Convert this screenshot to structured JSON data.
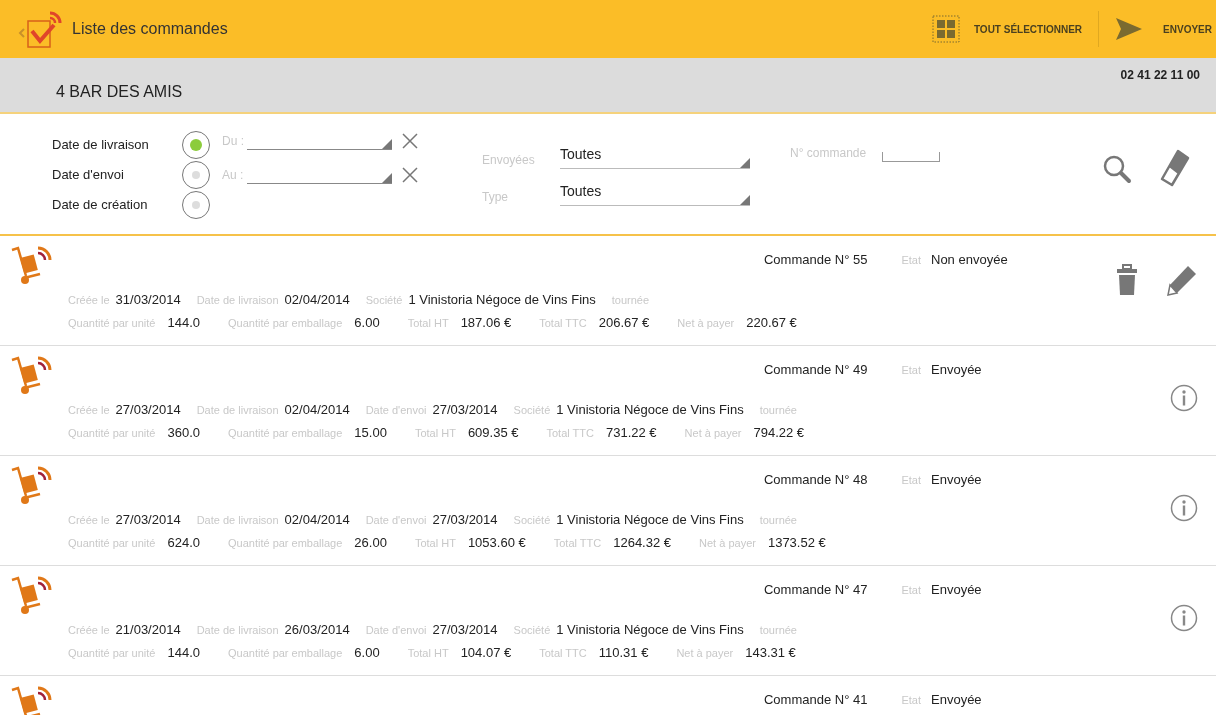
{
  "app_bar": {
    "title": "Liste des commandes",
    "actions": [
      {
        "kind": "select-all",
        "label": "TOUT SÉLECTIONNER"
      },
      {
        "kind": "send",
        "label": "ENVOYER"
      }
    ]
  },
  "customer": {
    "name": "4  BAR DES AMIS",
    "phone": "02 41 22 11 00"
  },
  "filters": {
    "date_types": [
      {
        "label": "Date de livraison",
        "selected": true
      },
      {
        "label": "Date d'envoi",
        "selected": false
      },
      {
        "label": "Date de création",
        "selected": false
      }
    ],
    "ranges": [
      {
        "label": "Du :"
      },
      {
        "label": "Au :"
      }
    ],
    "selects": [
      {
        "label": "Envoyées",
        "value": "Toutes"
      },
      {
        "label": "Type",
        "value": "Toutes"
      }
    ],
    "order_number": {
      "label": "N° commande"
    }
  },
  "orders": [
    {
      "number": "Commande N° 55",
      "state_label": "Etat",
      "state": "Non envoyée",
      "actions": [
        {
          "kind": "delete"
        },
        {
          "kind": "edit"
        }
      ],
      "line1": [
        {
          "label": "Créée le",
          "value": "31/03/2014"
        },
        {
          "label": "Date de livraison",
          "value": "02/04/2014"
        },
        {
          "label": "Société",
          "value": "1 Vinistoria Négoce de Vins Fins"
        },
        {
          "label": "tournée"
        }
      ],
      "line2": [
        {
          "label": "Quantité par unité",
          "value": "144.0"
        },
        {
          "label": "Quantité par emballage",
          "value": "6.00"
        },
        {
          "label": "Total HT",
          "value": "187.06 €"
        },
        {
          "label": "Total TTC",
          "value": "206.67 €"
        },
        {
          "label": "Net à payer",
          "value": "220.67 €"
        }
      ]
    },
    {
      "number": "Commande N° 49",
      "state_label": "Etat",
      "state": "Envoyée",
      "actions": [
        {
          "kind": "info"
        }
      ],
      "line1": [
        {
          "label": "Créée le",
          "value": "27/03/2014"
        },
        {
          "label": "Date de livraison",
          "value": "02/04/2014"
        },
        {
          "label": "Date d'envoi",
          "value": "27/03/2014"
        },
        {
          "label": "Société",
          "value": "1 Vinistoria Négoce de Vins Fins"
        },
        {
          "label": "tournée"
        }
      ],
      "line2": [
        {
          "label": "Quantité par unité",
          "value": "360.0"
        },
        {
          "label": "Quantité par emballage",
          "value": "15.00"
        },
        {
          "label": "Total HT",
          "value": "609.35 €"
        },
        {
          "label": "Total TTC",
          "value": "731.22 €"
        },
        {
          "label": "Net à payer",
          "value": "794.22 €"
        }
      ]
    },
    {
      "number": "Commande N° 48",
      "state_label": "Etat",
      "state": "Envoyée",
      "actions": [
        {
          "kind": "info"
        }
      ],
      "line1": [
        {
          "label": "Créée le",
          "value": "27/03/2014"
        },
        {
          "label": "Date de livraison",
          "value": "02/04/2014"
        },
        {
          "label": "Date d'envoi",
          "value": "27/03/2014"
        },
        {
          "label": "Société",
          "value": "1 Vinistoria Négoce de Vins Fins"
        },
        {
          "label": "tournée"
        }
      ],
      "line2": [
        {
          "label": "Quantité par unité",
          "value": "624.0"
        },
        {
          "label": "Quantité par emballage",
          "value": "26.00"
        },
        {
          "label": "Total HT",
          "value": "1053.60 €"
        },
        {
          "label": "Total TTC",
          "value": "1264.32 €"
        },
        {
          "label": "Net à payer",
          "value": "1373.52 €"
        }
      ]
    },
    {
      "number": "Commande N° 47",
      "state_label": "Etat",
      "state": "Envoyée",
      "actions": [
        {
          "kind": "info"
        }
      ],
      "line1": [
        {
          "label": "Créée le",
          "value": "21/03/2014"
        },
        {
          "label": "Date de livraison",
          "value": "26/03/2014"
        },
        {
          "label": "Date d'envoi",
          "value": "27/03/2014"
        },
        {
          "label": "Société",
          "value": "1 Vinistoria Négoce de Vins Fins"
        },
        {
          "label": "tournée"
        }
      ],
      "line2": [
        {
          "label": "Quantité par unité",
          "value": "144.0"
        },
        {
          "label": "Quantité par emballage",
          "value": "6.00"
        },
        {
          "label": "Total HT",
          "value": "104.07 €"
        },
        {
          "label": "Total TTC",
          "value": "110.31 €"
        },
        {
          "label": "Net à payer",
          "value": "143.31 €"
        }
      ]
    },
    {
      "number": "Commande N° 41",
      "state_label": "Etat",
      "state": "Envoyée"
    }
  ]
}
